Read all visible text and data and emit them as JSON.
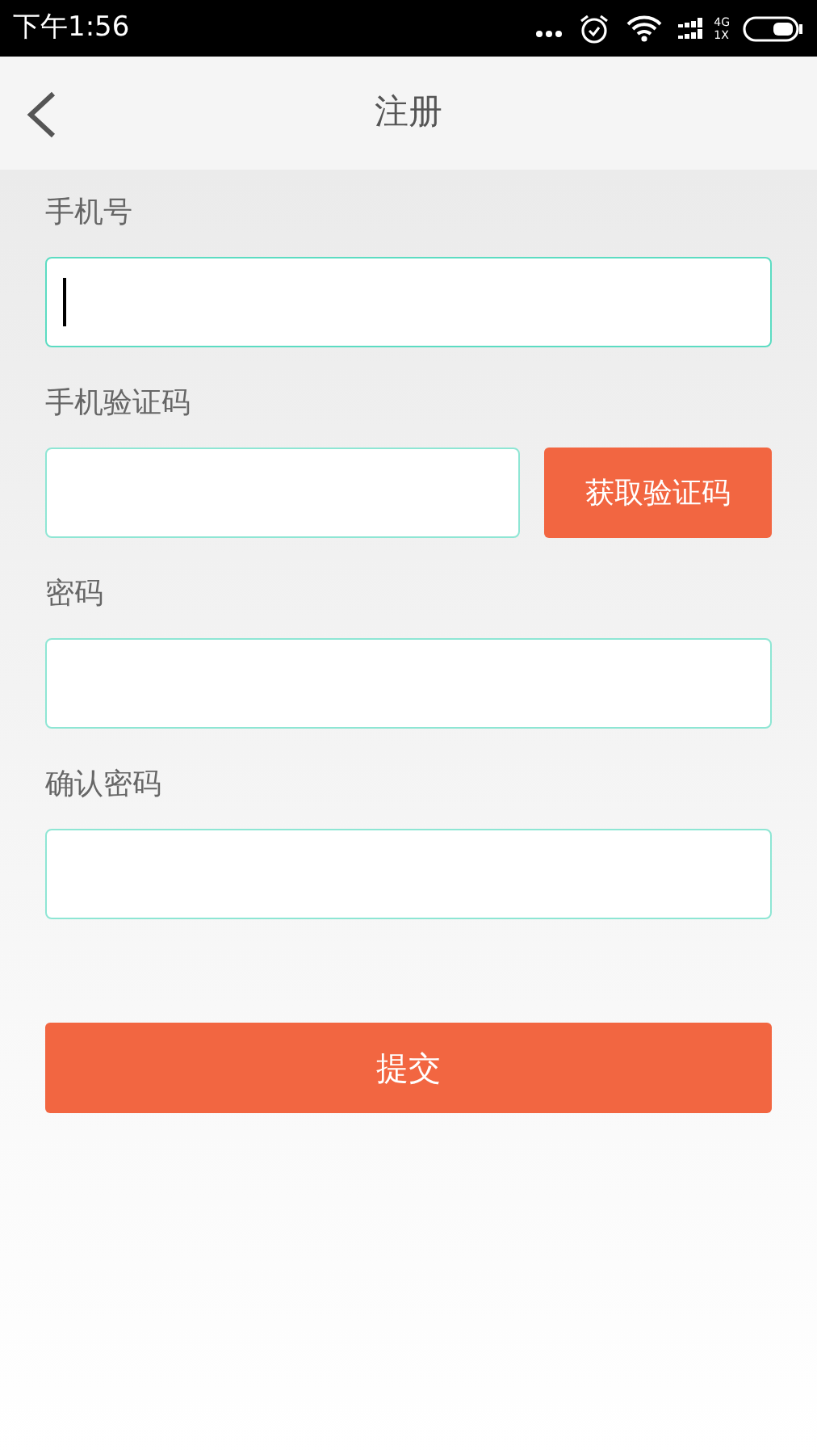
{
  "status_bar": {
    "time": "下午1:56",
    "network_top": "4G",
    "network_bottom": "1X"
  },
  "header": {
    "title": "注册"
  },
  "fields": [
    {
      "label": "手机号",
      "focused": true,
      "kind": "text"
    },
    {
      "label": "手机验证码",
      "focused": false,
      "kind": "code",
      "button": "获取验证码"
    },
    {
      "label": "密码",
      "focused": false,
      "kind": "text"
    },
    {
      "label": "确认密码",
      "focused": false,
      "kind": "text"
    }
  ],
  "submit": {
    "label": "提交"
  }
}
